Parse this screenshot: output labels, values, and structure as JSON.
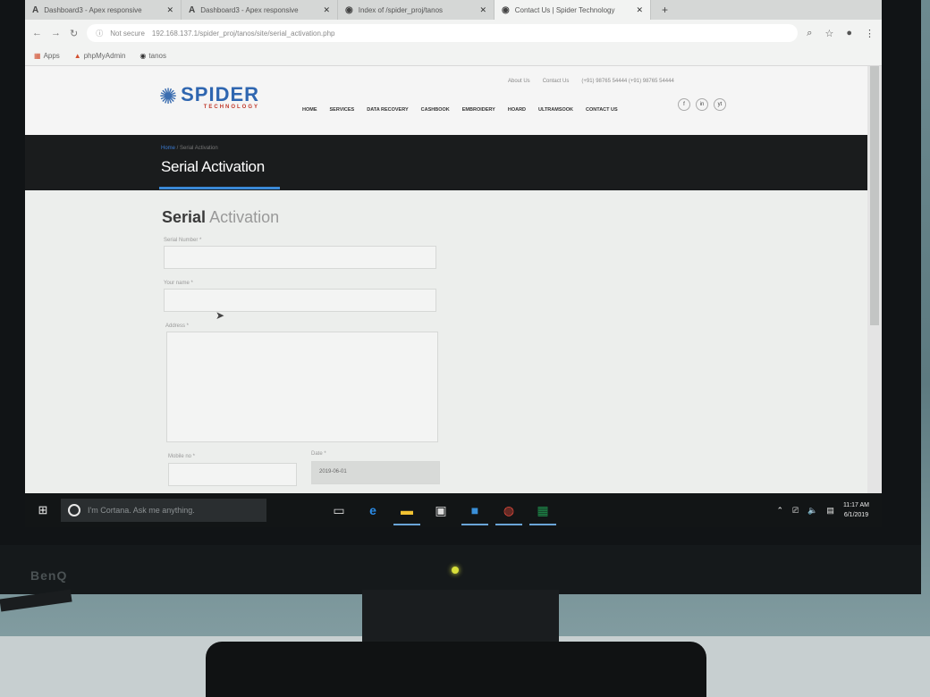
{
  "browser": {
    "tabs": [
      {
        "icon": "A",
        "title": "Dashboard3 - Apex responsive",
        "active": false
      },
      {
        "icon": "A",
        "title": "Dashboard3 - Apex responsive",
        "active": false
      },
      {
        "icon": "globe-icon",
        "title": "Index of /spider_proj/tanos",
        "active": false
      },
      {
        "icon": "globe-icon",
        "title": "Contact Us | Spider Technology",
        "active": true
      }
    ],
    "new_tab": "+",
    "security_label": "Not secure",
    "url": "192.168.137.1/spider_proj/tanos/site/serial_activation.php",
    "bookmarks": [
      "Apps",
      "phpMyAdmin",
      "tanos"
    ]
  },
  "site": {
    "logo_main": "SPIDER",
    "logo_sub": "TECHNOLOGY",
    "top_links": [
      "About Us",
      "Contact Us",
      "(+91) 98765 54444 (+91) 98765 54444"
    ],
    "nav": [
      "HOME",
      "SERVICES",
      "DATA RECOVERY",
      "CASHBOOK",
      "EMBROIDERY",
      "HOARD",
      "ULTRAMSOOK",
      "CONTACT US"
    ],
    "social": [
      "f",
      "in",
      "yt"
    ]
  },
  "page_title_bar": {
    "breadcrumb_home": "Home",
    "breadcrumb_sep": " / ",
    "breadcrumb_current": "Serial Activation",
    "title": "Serial Activation"
  },
  "form": {
    "heading_bold": "Serial",
    "heading_light": "Activation",
    "serial_label": "Serial Number *",
    "name_label": "Your name *",
    "address_label": "Address *",
    "mobile_label": "Mobile no *",
    "date_label": "Date *",
    "date_value": "2019-06-01"
  },
  "taskbar": {
    "cortana_placeholder": "I'm Cortana. Ask me anything.",
    "time": "11:17 AM",
    "date": "6/1/2019"
  },
  "monitor_brand": "BenQ"
}
